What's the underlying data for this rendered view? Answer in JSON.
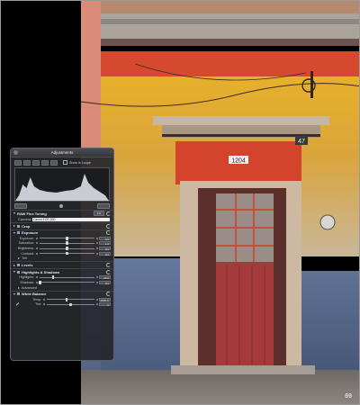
{
  "hud": {
    "title": "Adjustments",
    "show_in_loupe_label": "Show in Loupe",
    "histogram_footer_left": "",
    "histogram_footer_right": "",
    "raw": {
      "label": "RAW Fine Tuning",
      "value": "1.0",
      "camera_label": "Camera:",
      "camera_value": "Canon EOS 20D"
    },
    "crop": {
      "label": "Crop"
    },
    "exposure": {
      "label": "Exposure",
      "rows": [
        {
          "label": "Exposure:",
          "value": "0.0",
          "level": 0.5
        },
        {
          "label": "Saturation:",
          "value": "1.0",
          "level": 0.5
        },
        {
          "label": "Brightness:",
          "value": "0.0",
          "level": 0.5
        },
        {
          "label": "Contrast:",
          "value": "0.0",
          "level": 0.5
        }
      ],
      "tint_label": "Tint"
    },
    "levels": {
      "label": "Levels"
    },
    "highlights_shadows": {
      "label": "Highlights & Shadows",
      "rows": [
        {
          "label": "Highlights:",
          "value": "25.0",
          "level": 0.25
        },
        {
          "label": "Shadows:",
          "value": "0.0",
          "level": 0.02
        }
      ],
      "advanced_label": "Advanced"
    },
    "white_balance": {
      "label": "White Balance",
      "rows": [
        {
          "label": "Temp:",
          "value": "4900 K",
          "level": 0.42
        },
        {
          "label": "Tint:",
          "value": "0",
          "level": 0.5
        }
      ]
    }
  },
  "page_number": "69",
  "colors": {
    "hud_bg": "#26282c",
    "wall_yellow": "#e9b52a",
    "wall_red": "#d9462c",
    "door_red": "#a83a3a",
    "shadow_blue": "#5a6f93"
  }
}
